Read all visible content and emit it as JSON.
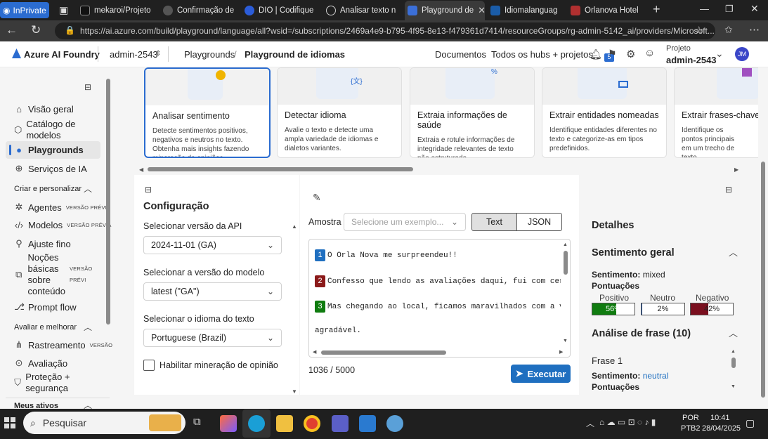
{
  "browser": {
    "inprivate_label": "InPrivate",
    "tabs": [
      {
        "label": "mekaroi/Projeto",
        "color": "#1a1a1a"
      },
      {
        "label": "Confirmação de",
        "color": "#444"
      },
      {
        "label": "DIO | Codifique",
        "color": "#2b5cd8"
      },
      {
        "label": "Analisar texto n",
        "color": "#777"
      },
      {
        "label": "Playground de",
        "color": "#3b6fd8"
      },
      {
        "label": "Idiomalanguag",
        "color": "#1a5ca8"
      },
      {
        "label": "Orlanova Hotel",
        "color": "#b03030"
      }
    ],
    "url": "https://ai.azure.com/build/playground/language/all?wsid=/subscriptions/2469a4e9-b795-4f95-8e13-f479361d7414/resourceGroups/rg-admin-5142_ai/providers/Microsoft..."
  },
  "header": {
    "brand": "Azure AI Foundry",
    "workspace": "admin-2543",
    "crumb1": "Playgrounds",
    "crumb2": "Playground de idiomas",
    "docs": "Documentos",
    "hubs": "Todos os hubs + projetos",
    "notif_count": "5",
    "project_label": "Projeto",
    "project_name": "admin-2543",
    "avatar": "JM"
  },
  "nav": {
    "items": [
      {
        "label": "Visão geral"
      },
      {
        "label": "Catálogo de modelos"
      },
      {
        "label": "Playgrounds"
      },
      {
        "label": "Serviços de IA"
      }
    ],
    "section1": "Criar e personalizar",
    "items2": [
      {
        "label": "Agentes",
        "badge": "VERSÃO PRÉVIA"
      },
      {
        "label": "Modelos",
        "badge": "VERSÃO PRÉVIA"
      },
      {
        "label": "Ajuste fino",
        "badge": ""
      },
      {
        "label": "Noções básicas sobre conteúdo",
        "badge": "VERSÃO PRÉVI"
      },
      {
        "label": "Prompt flow",
        "badge": ""
      }
    ],
    "section2": "Avaliar e melhorar",
    "items3": [
      {
        "label": "Rastreamento",
        "badge": "VERSÃO"
      },
      {
        "label": "Avaliação",
        "badge": ""
      },
      {
        "label": "Proteção + segurança",
        "badge": ""
      }
    ],
    "section3": "Meus ativos"
  },
  "cards": [
    {
      "title": "Analisar sentimento",
      "desc": "Detecte sentimentos positivos, negativos e neutros no texto. Obtenha mais insights fazendo mineração de opiniões."
    },
    {
      "title": "Detectar idioma",
      "desc": "Avalie o texto e detecte uma ampla variedade de idiomas e dialetos variantes."
    },
    {
      "title": "Extraia informações de saúde",
      "desc": "Extraia e rotule informações de integridade relevantes de texto não estruturado."
    },
    {
      "title": "Extrair entidades nomeadas",
      "desc": "Identifique entidades diferentes no texto e categorize-as em tipos predefinidos."
    },
    {
      "title": "Extrair frases-chave",
      "desc": "Identifique os pontos principais em um trecho de texto."
    }
  ],
  "config": {
    "title": "Configuração",
    "api_label": "Selecionar versão da API",
    "api_value": "2024-11-01 (GA)",
    "model_label": "Selecionar a versão do modelo",
    "model_value": "latest (\"GA\")",
    "lang_label": "Selecionar o idioma do texto",
    "lang_value": "Portuguese (Brazil)",
    "opinion_label": "Habilitar mineração de opinião"
  },
  "editor": {
    "sample_label": "Amostra",
    "sample_placeholder": "Selecione um exemplo...",
    "text_btn": "Text",
    "json_btn": "JSON",
    "lines": [
      {
        "n": "1",
        "text": "O Orla Nova me surpreendeu!!",
        "color": "#1f6fc0"
      },
      {
        "n": "2",
        "text": "Confesso que lendo as avaliações daqui, fui com certo",
        "color": "#8b1a1a"
      },
      {
        "n": "3",
        "text": "Mas chegando ao local, ficamos maravilhados com a vist",
        "color": "#107c10"
      }
    ],
    "line3b": "agradável.",
    "counter": "1036 / 5000",
    "run_btn": "Executar"
  },
  "details": {
    "title": "Detalhes",
    "overall": "Sentimento geral",
    "sent_label": "Sentimento:",
    "sent_value": "mixed",
    "scores": "Pontuações",
    "pos_label": "Positivo",
    "neu_label": "Neutro",
    "neg_label": "Negativo",
    "pos_val": "56%",
    "neu_val": "2%",
    "neg_val": "42%",
    "pos_frac": 0.56,
    "neu_frac": 0.02,
    "neg_frac": 0.42,
    "phrase_title": "Análise de frase (10)",
    "phrase1": "Frase 1",
    "p1_sent_value": "neutral",
    "p1_scores": "Pontuações"
  },
  "taskbar": {
    "search": "Pesquisar",
    "lang1": "POR",
    "lang2": "PTB2",
    "time": "10:41",
    "date": "28/04/2025"
  }
}
